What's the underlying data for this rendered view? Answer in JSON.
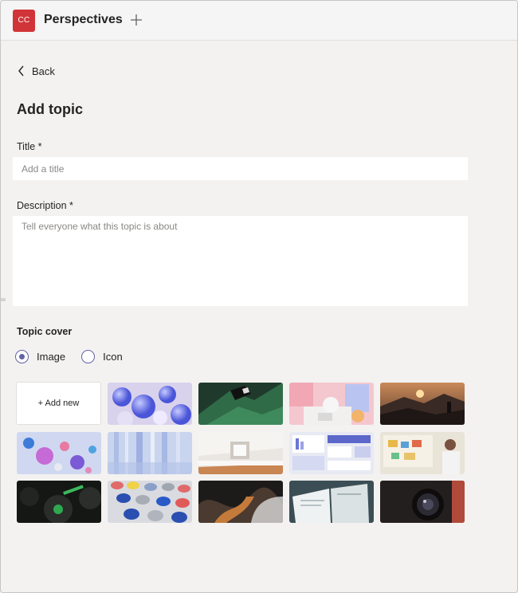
{
  "header": {
    "avatar_initials": "CC",
    "avatar_color": "#d13438",
    "app_name": "Perspectives"
  },
  "nav": {
    "back_label": "Back"
  },
  "form": {
    "heading": "Add topic",
    "title_label": "Title *",
    "title_placeholder": "Add a title",
    "title_value": "",
    "description_label": "Description *",
    "description_placeholder": "Tell everyone what this topic is about",
    "description_value": ""
  },
  "cover": {
    "label": "Topic cover",
    "options": [
      {
        "label": "Image",
        "selected": true
      },
      {
        "label": "Icon",
        "selected": false
      }
    ],
    "add_new_label": "+ Add new",
    "thumbnails": [
      "blue-spheres",
      "green-ribbon",
      "pastel-blocks",
      "mountain-sunset",
      "floating-balls",
      "glass-rods",
      "white-interior",
      "dashboard-collage",
      "person-at-board",
      "green-gears",
      "colored-discs",
      "fabric-swirl",
      "open-book",
      "camera-lens"
    ]
  },
  "colors": {
    "accent": "#6264a7",
    "background": "#f3f2f1"
  }
}
